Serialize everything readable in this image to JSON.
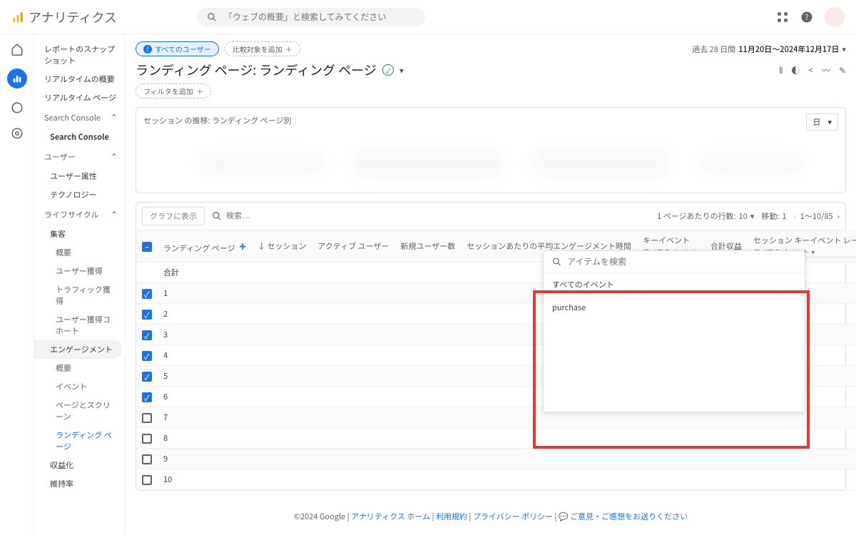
{
  "brand": "アナリティクス",
  "search_placeholder": "「ウェブの概要」と検索してみてください",
  "rail": {
    "home": "home",
    "reports": "reports",
    "explore": "explore",
    "ads": "ads"
  },
  "sidenav": {
    "snapshot": "レポートのスナップショット",
    "realtime_summary": "リアルタイムの概要",
    "realtime_page": "リアルタイム ページ",
    "search_console_section": "Search Console",
    "search_console_item": "Search Console",
    "user_section": "ユーザー",
    "user_attr": "ユーザー属性",
    "tech": "テクノロジー",
    "lifecycle_section": "ライフサイクル",
    "acquisition": "集客",
    "acq_summary": "概要",
    "user_acq": "ユーザー獲得",
    "traffic_acq": "トラフィック獲得",
    "user_cohort": "ユーザー獲得コホート",
    "engagement": "エンゲージメント",
    "eng_summary": "概要",
    "events": "イベント",
    "pages": "ページとスクリーン",
    "landing": "ランディング ページ",
    "monetize": "収益化",
    "retention": "維持率"
  },
  "page": {
    "chip_all_users": "すべてのユーザー",
    "chip_compare": "比較対象を追加",
    "date_prefix": "過去 28 日間",
    "date_range": "11月20日〜2024年12月17日",
    "title": "ランディング ページ: ランディング ページ",
    "filter_chip": "フィルタを追加"
  },
  "chart": {
    "title": "セッション の推移: ランディング ページ別",
    "day_select": "日"
  },
  "table_toolbar": {
    "graph_btn": "グラフに表示",
    "search_placeholder": "検索…",
    "rows_label": "1 ページあたりの行数:",
    "rows_value": "10",
    "move_label": "移動:",
    "move_value": "1",
    "range": "1〜10/85"
  },
  "columns": {
    "landing": "ランディング ページ",
    "sessions": "セッション",
    "active_users": "アクティブ ユーザー",
    "new_users": "新規ユーザー数",
    "avg_engagement": "セッションあたりの平均エンゲージメント時間",
    "key_events": "キーイベント",
    "all_events_sub": "すべてのイベント",
    "total_revenue": "合計収益",
    "key_event_rate": "セッション キーイベント レート",
    "key_event_rate_sub": "すべてのイベント"
  },
  "dropdown": {
    "search_placeholder": "アイテムを検索",
    "all_events": "すべてのイベント",
    "item1": "purchase"
  },
  "rows": {
    "total": "合計",
    "r1": "1",
    "r2": "2",
    "r3": "3",
    "r4": "4",
    "r5": "5",
    "r6": "6",
    "r7": "7",
    "r8": "8",
    "r9": "9",
    "r10": "10"
  },
  "footer": {
    "copyright": "©2024 Google",
    "home": "アナリティクス ホーム",
    "tos": "利用規約",
    "privacy": "プライバシー ポリシー",
    "feedback": "ご意見・ご感想をお送りください"
  }
}
